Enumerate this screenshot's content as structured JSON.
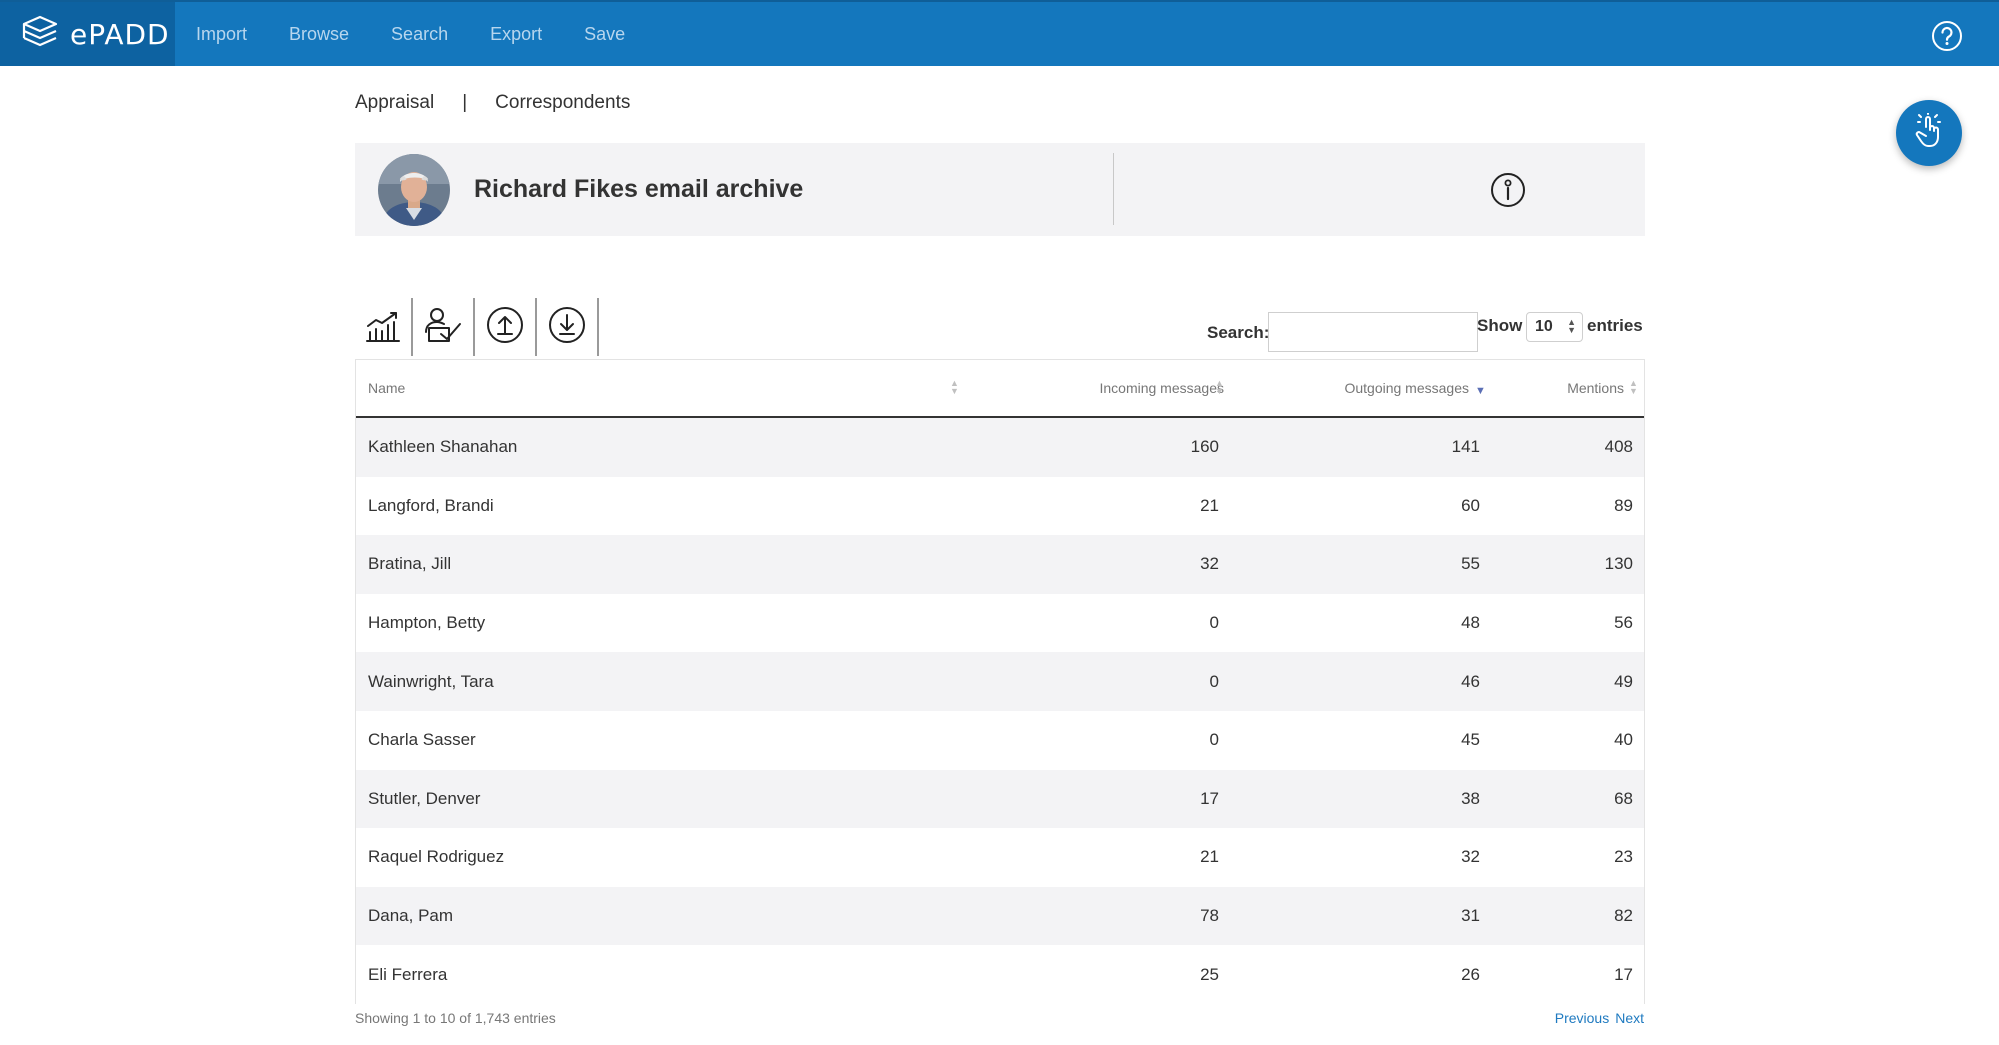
{
  "app": {
    "brand": "ePADD",
    "nav": [
      "Import",
      "Browse",
      "Search",
      "Export",
      "Save"
    ]
  },
  "breadcrumb": {
    "items": [
      "Appraisal",
      "Correspondents"
    ],
    "separator": "|"
  },
  "archive": {
    "title": "Richard Fikes email archive"
  },
  "toolbar": {
    "icons": [
      "graph-icon",
      "person-check-icon",
      "upload-icon",
      "download-icon"
    ]
  },
  "controls": {
    "search_label": "Search:",
    "search_value": "",
    "show_label": "Show",
    "show_value": "10",
    "entries_label": "entries"
  },
  "table": {
    "columns": [
      "Name",
      "Incoming messages",
      "Outgoing messages",
      "Mentions"
    ],
    "sorted_column": "Outgoing messages",
    "sort_direction": "desc",
    "rows": [
      {
        "name": "Kathleen Shanahan",
        "incoming": "160",
        "outgoing": "141",
        "mentions": "408"
      },
      {
        "name": "Langford, Brandi",
        "incoming": "21",
        "outgoing": "60",
        "mentions": "89"
      },
      {
        "name": "Bratina, Jill",
        "incoming": "32",
        "outgoing": "55",
        "mentions": "130"
      },
      {
        "name": "Hampton, Betty",
        "incoming": "0",
        "outgoing": "48",
        "mentions": "56"
      },
      {
        "name": "Wainwright, Tara",
        "incoming": "0",
        "outgoing": "46",
        "mentions": "49"
      },
      {
        "name": "Charla Sasser",
        "incoming": "0",
        "outgoing": "45",
        "mentions": "40"
      },
      {
        "name": "Stutler, Denver",
        "incoming": "17",
        "outgoing": "38",
        "mentions": "68"
      },
      {
        "name": "Raquel Rodriguez",
        "incoming": "21",
        "outgoing": "32",
        "mentions": "23"
      },
      {
        "name": "Dana, Pam",
        "incoming": "78",
        "outgoing": "31",
        "mentions": "82"
      },
      {
        "name": "Eli Ferrera",
        "incoming": "25",
        "outgoing": "26",
        "mentions": "17"
      }
    ],
    "info": "Showing 1 to 10 of 1,743 entries",
    "pager": {
      "previous": "Previous",
      "next": "Next"
    }
  },
  "colors": {
    "navbar": "#1477bd",
    "brand_bg": "#0d62a1",
    "stripe": "#f3f3f5",
    "link": "#1f7ac0"
  }
}
